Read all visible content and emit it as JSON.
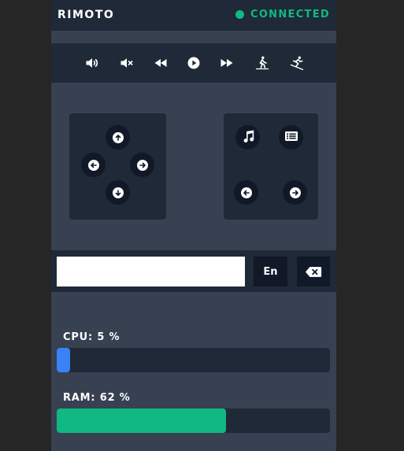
{
  "header": {
    "title": "RIMOTO",
    "status": "CONNECTED",
    "status_color": "#10b981"
  },
  "media_controls": [
    {
      "name": "volume-up-icon"
    },
    {
      "name": "mute-icon"
    },
    {
      "name": "rewind-icon"
    },
    {
      "name": "play-icon"
    },
    {
      "name": "fast-forward-icon"
    },
    {
      "name": "person-walking-icon"
    },
    {
      "name": "person-skiing-icon"
    }
  ],
  "left_pad": {
    "buttons": [
      "arrow-up-icon",
      "arrow-left-icon",
      "arrow-right-icon",
      "arrow-down-icon"
    ]
  },
  "right_pad": {
    "buttons": [
      "music-note-icon",
      "list-icon",
      "arrow-left-icon",
      "arrow-right-icon"
    ]
  },
  "text_input": {
    "value": "",
    "placeholder": ""
  },
  "lang_button": "En",
  "stats": {
    "cpu": {
      "label_prefix": "CPU:",
      "value": "5",
      "unit": "%",
      "fraction": 0.05,
      "color": "#3b82f6"
    },
    "ram": {
      "label_prefix": "RAM:",
      "value": "62",
      "unit": "%",
      "fraction": 0.62,
      "color": "#10b981"
    }
  },
  "colors": {
    "background": "#374151",
    "panel": "#1f2937",
    "button": "#111827",
    "accent_green": "#10b981",
    "accent_blue": "#3b82f6"
  }
}
